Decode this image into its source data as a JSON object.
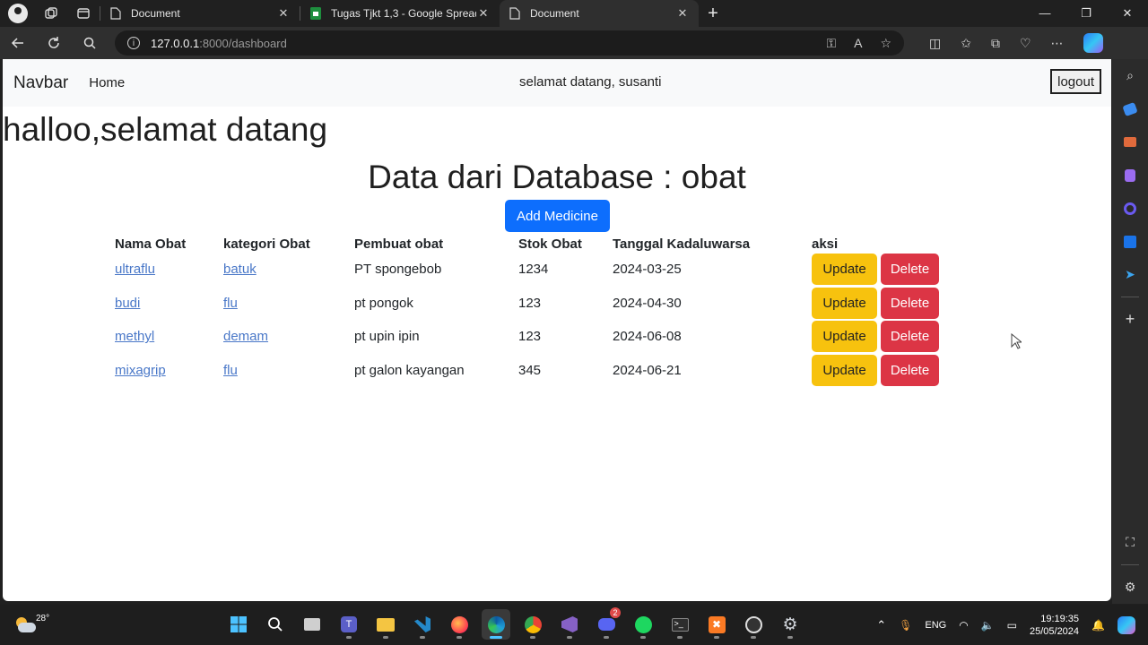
{
  "browser": {
    "tabs": [
      {
        "title": "Document",
        "active": false,
        "favicon": "document-icon"
      },
      {
        "title": "Tugas Tjkt 1,3 - Google Spreadsh",
        "active": false,
        "favicon": "sheets-icon"
      },
      {
        "title": "Document",
        "active": true,
        "favicon": "document-icon"
      }
    ],
    "url_host": "127.0.0.1",
    "url_rest": ":8000/dashboard"
  },
  "page": {
    "navbar": {
      "brand": "Navbar",
      "home": "Home",
      "welcome": "selamat datang, susanti",
      "logout": "logout"
    },
    "greeting": "halloo,selamat datang",
    "title": "Data dari Database : obat",
    "add_button": "Add Medicine",
    "table": {
      "headers": [
        "Nama Obat",
        "kategori Obat",
        "Pembuat obat",
        "Stok Obat",
        "Tanggal Kadaluwarsa",
        "aksi"
      ],
      "rows": [
        {
          "nama": "ultraflu",
          "kategori": "batuk",
          "pembuat": "PT spongebob",
          "stok": "1234",
          "tanggal": "2024-03-25"
        },
        {
          "nama": "budi",
          "kategori": "flu",
          "pembuat": "pt pongok",
          "stok": "123",
          "tanggal": "2024-04-30"
        },
        {
          "nama": "methyl",
          "kategori": "demam",
          "pembuat": "pt upin ipin",
          "stok": "123",
          "tanggal": "2024-06-08"
        },
        {
          "nama": "mixagrip",
          "kategori": "flu",
          "pembuat": "pt galon kayangan",
          "stok": "345",
          "tanggal": "2024-06-21"
        }
      ],
      "update_label": "Update",
      "delete_label": "Delete"
    }
  },
  "taskbar": {
    "temperature": "28°",
    "language": "ENG",
    "time": "19:19:35",
    "date": "25/05/2024",
    "discord_badge": "2"
  },
  "colors": {
    "primary": "#0d6efd",
    "warning": "#f7c20e",
    "danger": "#dc3545",
    "link": "#4a78c8",
    "navbar_bg": "#f8f9fa"
  }
}
